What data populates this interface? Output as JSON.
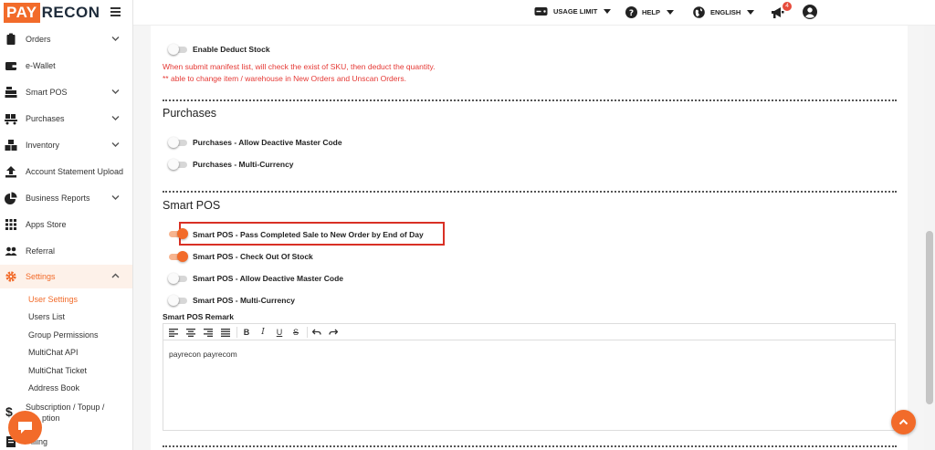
{
  "app": {
    "logo_pay": "PAY",
    "logo_recon": "RECON"
  },
  "topbar": {
    "usage_limit": "USAGE LIMIT",
    "help": "HELP",
    "language": "ENGLISH",
    "notification_count": "4"
  },
  "sidebar": {
    "items": [
      {
        "label": "Orders"
      },
      {
        "label": "e-Wallet"
      },
      {
        "label": "Smart POS"
      },
      {
        "label": "Purchases"
      },
      {
        "label": "Inventory"
      },
      {
        "label": "Account Statement Upload"
      },
      {
        "label": "Business Reports"
      },
      {
        "label": "Apps Store"
      },
      {
        "label": "Referral"
      },
      {
        "label": "Settings"
      }
    ],
    "settings_sub": [
      {
        "label": "User Settings"
      },
      {
        "label": "Users List"
      },
      {
        "label": "Group Permissions"
      },
      {
        "label": "MultiChat API"
      },
      {
        "label": "MultiChat Ticket"
      },
      {
        "label": "Address Book"
      }
    ],
    "subscription_line1": "Subscription / Topup /",
    "subscription_line2": "ption",
    "billing": "illing"
  },
  "content": {
    "deduct_stock": {
      "label": "Enable Deduct Stock",
      "on": false,
      "note1": "When submit manifest list, will check the exist of SKU, then deduct the quantity.",
      "note2": "** able to change item / warehouse in New Orders and Unscan Orders."
    },
    "purchases": {
      "title": "Purchases",
      "toggles": [
        {
          "label": "Purchases - Allow Deactive Master Code",
          "on": false
        },
        {
          "label": "Purchases - Multi-Currency",
          "on": false
        }
      ]
    },
    "smart_pos": {
      "title": "Smart POS",
      "toggles": [
        {
          "label": "Smart POS - Pass Completed Sale to New Order by End of Day",
          "on": true
        },
        {
          "label": "Smart POS - Check Out Of Stock",
          "on": true
        },
        {
          "label": "Smart POS - Allow Deactive Master Code",
          "on": false
        },
        {
          "label": "Smart POS - Multi-Currency",
          "on": false
        }
      ],
      "remark_label": "Smart POS Remark",
      "remark_text": "payrecon payrecom"
    }
  },
  "colors": {
    "accent": "#f26b2a",
    "highlight": "#d93025",
    "note": "#e53935"
  }
}
